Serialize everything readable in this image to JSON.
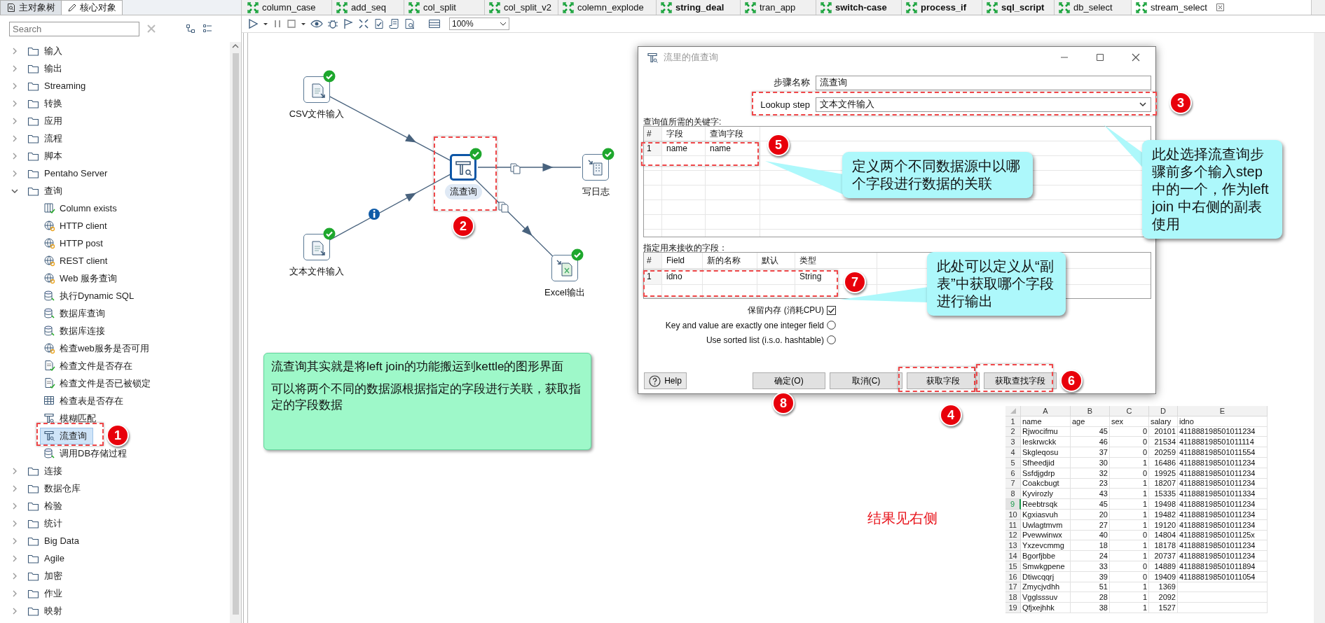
{
  "left_panel": {
    "tabs": [
      {
        "label": "主对象树",
        "selected": false
      },
      {
        "label": "核心对象",
        "selected": true
      }
    ],
    "search": {
      "placeholder": "Search"
    },
    "tree": [
      {
        "label": "输入",
        "expanded": false
      },
      {
        "label": "输出",
        "expanded": false
      },
      {
        "label": "Streaming",
        "expanded": false
      },
      {
        "label": "转换",
        "expanded": false
      },
      {
        "label": "应用",
        "expanded": false
      },
      {
        "label": "流程",
        "expanded": false
      },
      {
        "label": "脚本",
        "expanded": false
      },
      {
        "label": "Pentaho Server",
        "expanded": false
      },
      {
        "label": "查询",
        "expanded": true,
        "children": [
          {
            "label": "Column exists",
            "selected": false
          },
          {
            "label": "HTTP client",
            "selected": false
          },
          {
            "label": "HTTP post",
            "selected": false
          },
          {
            "label": "REST client",
            "selected": false
          },
          {
            "label": "Web 服务查询",
            "selected": false
          },
          {
            "label": "执行Dynamic SQL",
            "selected": false
          },
          {
            "label": "数据库查询",
            "selected": false
          },
          {
            "label": "数据库连接",
            "selected": false
          },
          {
            "label": "检查web服务是否可用",
            "selected": false
          },
          {
            "label": "检查文件是否存在",
            "selected": false
          },
          {
            "label": "检查文件是否已被锁定",
            "selected": false
          },
          {
            "label": "检查表是否存在",
            "selected": false
          },
          {
            "label": "模糊匹配",
            "selected": false
          },
          {
            "label": "流查询",
            "selected": true
          },
          {
            "label": "调用DB存储过程",
            "selected": false
          }
        ]
      },
      {
        "label": "连接",
        "expanded": false
      },
      {
        "label": "数据仓库",
        "expanded": false
      },
      {
        "label": "检验",
        "expanded": false
      },
      {
        "label": "统计",
        "expanded": false
      },
      {
        "label": "Big Data",
        "expanded": false
      },
      {
        "label": "Agile",
        "expanded": false
      },
      {
        "label": "加密",
        "expanded": false
      },
      {
        "label": "作业",
        "expanded": false
      },
      {
        "label": "映射",
        "expanded": false
      }
    ]
  },
  "editor_tabs": [
    {
      "label": "column_case",
      "bold": false,
      "selected": false
    },
    {
      "label": "add_seq",
      "bold": false,
      "selected": false
    },
    {
      "label": "col_split",
      "bold": false,
      "selected": false
    },
    {
      "label": "col_split_v2",
      "bold": false,
      "selected": false
    },
    {
      "label": "colemn_explode",
      "bold": false,
      "selected": false
    },
    {
      "label": "string_deal",
      "bold": true,
      "selected": false
    },
    {
      "label": "tran_app",
      "bold": false,
      "selected": false
    },
    {
      "label": "switch-case",
      "bold": true,
      "selected": false
    },
    {
      "label": "process_if",
      "bold": true,
      "selected": false
    },
    {
      "label": "sql_script",
      "bold": true,
      "selected": false
    },
    {
      "label": "db_select",
      "bold": false,
      "selected": false
    },
    {
      "label": "stream_select",
      "bold": false,
      "selected": true
    }
  ],
  "toolbar": {
    "zoom": "100%"
  },
  "canvas": {
    "steps": [
      {
        "label": "CSV文件输入",
        "selected": false
      },
      {
        "label": "文本文件输入",
        "selected": false
      },
      {
        "label": "流查询",
        "selected": true
      },
      {
        "label": "写日志",
        "selected": false
      },
      {
        "label": "Excel输出",
        "selected": false
      }
    ],
    "note": [
      "流查询其实就是将left join的功能搬运到kettle的图形界面",
      "可以将两个不同的数据源根据指定的字段进行关联，获取指定的字段数据"
    ],
    "result_note": "结果见右侧"
  },
  "dialog": {
    "title": "流里的值查询",
    "step_name": {
      "label": "步骤名称",
      "value": "流查询"
    },
    "lookup_step": {
      "label": "Lookup step",
      "value": "文本文件输入"
    },
    "keys": {
      "label": "查询值所需的关键字:",
      "columns": [
        "#",
        "字段",
        "查询字段"
      ],
      "rows": [
        {
          "num": "1",
          "field": "name",
          "lookup_field": "name"
        }
      ]
    },
    "fields": {
      "label": "指定用来接收的字段：",
      "columns": [
        "#",
        "Field",
        "新的名称",
        "默认",
        "类型"
      ],
      "rows": [
        {
          "num": "1",
          "field": "idno",
          "type": "String"
        }
      ]
    },
    "options": [
      {
        "label": "保留内存 (消耗CPU)",
        "kind": "checkbox",
        "checked": true
      },
      {
        "label": "Key and value are exactly one integer field",
        "kind": "radio",
        "checked": false
      },
      {
        "label": "Use sorted list (i.s.o. hashtable)",
        "kind": "radio",
        "checked": false
      }
    ],
    "help": "Help",
    "buttons": [
      "确定(O)",
      "取消(C)",
      "获取字段",
      "获取查找字段"
    ]
  },
  "callouts": [
    "定义两个不同数据源中以哪个字段进行数据的关联",
    "此处可以定义从“副表”中获取哪个字段进行输出",
    "此处选择流查询步骤前多个输入step中的一个，作为left join 中右侧的副表使用"
  ],
  "badges": [
    "1",
    "2",
    "3",
    "4",
    "5",
    "6",
    "7",
    "8"
  ],
  "spreadsheet": {
    "columns": [
      "A",
      "B",
      "C",
      "D",
      "E"
    ],
    "rows": [
      {
        "num": "1",
        "selected": false,
        "cells": [
          "name",
          "age",
          "sex",
          "salary",
          "idno"
        ]
      },
      {
        "num": "2",
        "selected": false,
        "cells": [
          "Rjwocifmu",
          "45",
          "0",
          "20101",
          "411888198501011234"
        ]
      },
      {
        "num": "3",
        "selected": false,
        "cells": [
          "Ieskrwckk",
          "46",
          "0",
          "21534",
          "411888198501011114"
        ]
      },
      {
        "num": "4",
        "selected": false,
        "cells": [
          "Skgleqosu",
          "37",
          "0",
          "20259",
          "411888198501011554"
        ]
      },
      {
        "num": "5",
        "selected": false,
        "cells": [
          "Sfheedjid",
          "30",
          "1",
          "16486",
          "411888198501011234"
        ]
      },
      {
        "num": "6",
        "selected": false,
        "cells": [
          "Ssfdjgdrp",
          "32",
          "0",
          "19925",
          "411888198501011234"
        ]
      },
      {
        "num": "7",
        "selected": false,
        "cells": [
          "Coakcbugt",
          "23",
          "1",
          "18207",
          "411888198501011234"
        ]
      },
      {
        "num": "8",
        "selected": false,
        "cells": [
          "Kyvirozly",
          "43",
          "1",
          "15335",
          "411888198501011334"
        ]
      },
      {
        "num": "9",
        "selected": true,
        "cells": [
          "Reebtrsqk",
          "45",
          "1",
          "19498",
          "411888198501011234"
        ]
      },
      {
        "num": "10",
        "selected": false,
        "cells": [
          "Kgxiasvuh",
          "20",
          "1",
          "19482",
          "411888198501011234"
        ]
      },
      {
        "num": "11",
        "selected": false,
        "cells": [
          "Uwlagtmvm",
          "27",
          "1",
          "19120",
          "411888198501011234"
        ]
      },
      {
        "num": "12",
        "selected": false,
        "cells": [
          "Pvewwinwx",
          "40",
          "0",
          "14804",
          "41188819850101125x"
        ]
      },
      {
        "num": "13",
        "selected": false,
        "cells": [
          "Yxzevcmmg",
          "18",
          "1",
          "18178",
          "411888198501011234"
        ]
      },
      {
        "num": "14",
        "selected": false,
        "cells": [
          "Bgorfjbbe",
          "24",
          "1",
          "20737",
          "411888198501011234"
        ]
      },
      {
        "num": "15",
        "selected": false,
        "cells": [
          "Smwkgpene",
          "33",
          "0",
          "14889",
          "411888198501011894"
        ]
      },
      {
        "num": "16",
        "selected": false,
        "cells": [
          "Dtiwcqqrj",
          "39",
          "0",
          "19409",
          "411888198501011054"
        ]
      },
      {
        "num": "17",
        "selected": false,
        "cells": [
          "Zmycjvdhh",
          "51",
          "1",
          "1369"
        ]
      },
      {
        "num": "18",
        "selected": false,
        "cells": [
          "Vgglsssuv",
          "28",
          "1",
          "2092"
        ]
      },
      {
        "num": "19",
        "selected": false,
        "cells": [
          "Qfjxejhhk",
          "38",
          "1",
          "1527"
        ]
      }
    ]
  }
}
